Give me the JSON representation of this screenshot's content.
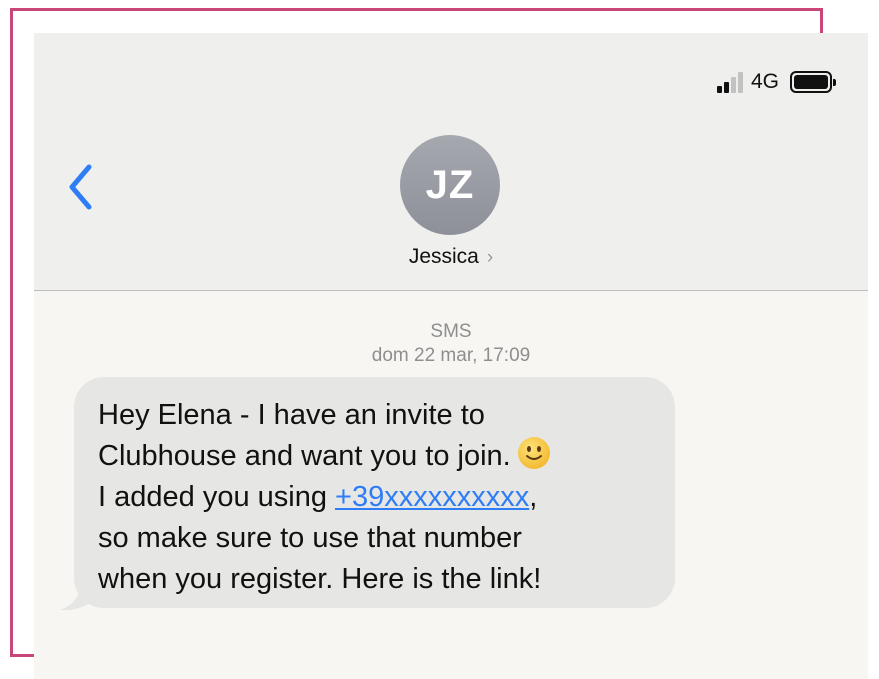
{
  "status_bar": {
    "network": "4G",
    "signal_bars_active": 2,
    "signal_bars_total": 4,
    "battery_level": 1.0
  },
  "header": {
    "back_icon": "chevron-left-icon",
    "avatar_initials": "JZ",
    "contact_name": "Jessica",
    "contact_chevron": "›"
  },
  "thread": {
    "service": "SMS",
    "timestamp": "dom 22 mar, 17:09"
  },
  "message": {
    "line1": "Hey Elena - I have an invite to",
    "line2": "Clubhouse and want you to join.",
    "line2_emoji": "slightly-smiling-face-icon",
    "line3_prefix": "I added you using ",
    "phone_link": "+39xxxxxxxxxx",
    "line3_suffix": ",",
    "line4": "so make sure to use that number",
    "line5": "when you register. Here is the link!"
  },
  "colors": {
    "frame_accent": "#c9467a",
    "link": "#2f7df6",
    "back_chevron": "#2f7df6",
    "bubble": "#e6e6e4",
    "header_bg": "#efefed"
  }
}
